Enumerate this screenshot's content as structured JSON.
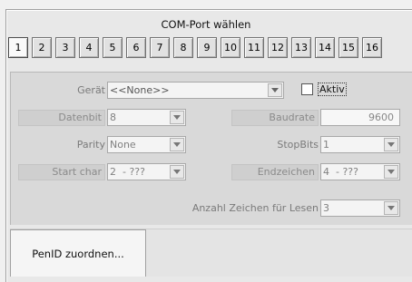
{
  "title": "COM-Port wählen",
  "tabs": [
    "1",
    "2",
    "3",
    "4",
    "5",
    "6",
    "7",
    "8",
    "9",
    "10",
    "11",
    "12",
    "13",
    "14",
    "15",
    "16"
  ],
  "selected_tab": "1",
  "fields": {
    "geraet": {
      "label": "Gerät",
      "value": "<<None>>"
    },
    "aktiv": {
      "label": "Aktiv",
      "checked": false
    },
    "datenbit": {
      "label": "Datenbit",
      "value": "8"
    },
    "baudrate": {
      "label": "Baudrate",
      "value": "9600"
    },
    "parity": {
      "label": "Parity",
      "value": "None"
    },
    "stopbits": {
      "label": "StopBits",
      "value": "1"
    },
    "startchar": {
      "label": "Start char",
      "value": "2  - ???"
    },
    "endzeichen": {
      "label": "Endzeichen",
      "value": "4  - ???"
    },
    "anzahl": {
      "label": "Anzahl Zeichen für Lesen",
      "value": "3"
    }
  },
  "button": {
    "label": "PenID zuordnen..."
  }
}
